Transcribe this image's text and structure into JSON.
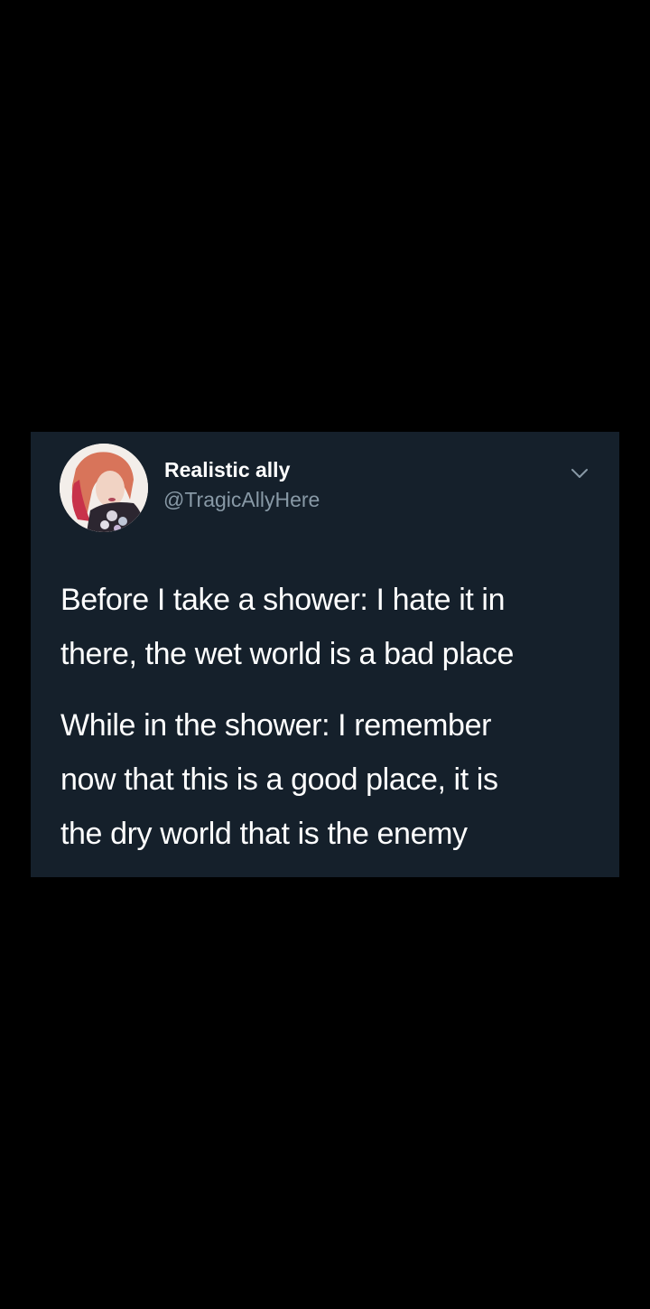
{
  "tweet": {
    "author": {
      "display_name": "Realistic ally",
      "handle": "@TragicAllyHere",
      "avatar_icon": "profile-photo"
    },
    "menu_icon": "chevron-down-icon",
    "paragraphs": [
      {
        "lines": [
          "Before I take a shower: I hate it in",
          "there, the wet world is a bad place"
        ]
      },
      {
        "lines": [
          "While in the shower: I remember",
          "now that this is a good place, it is",
          "the dry world that is the enemy"
        ]
      }
    ]
  },
  "colors": {
    "page_background": "#000000",
    "card_background": "#15202b",
    "primary_text": "#ffffff",
    "secondary_text": "#8899a6"
  }
}
